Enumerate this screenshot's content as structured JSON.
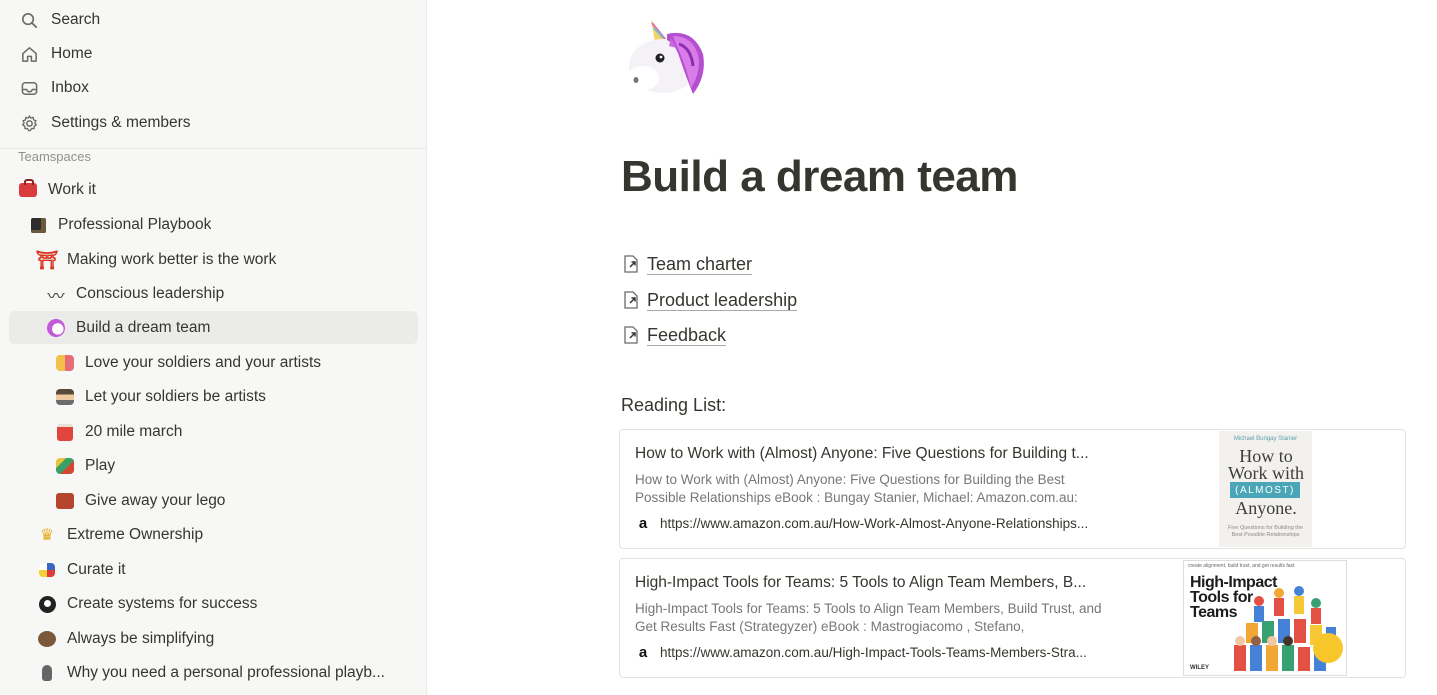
{
  "sidebar": {
    "nav": [
      {
        "label": "Search",
        "icon": "search-icon"
      },
      {
        "label": "Home",
        "icon": "home-icon"
      },
      {
        "label": "Inbox",
        "icon": "inbox-icon"
      },
      {
        "label": "Settings & members",
        "icon": "gear-icon"
      }
    ],
    "section_label": "Teamspaces",
    "tree": [
      {
        "label": "Work it",
        "icon": "toolbox-emoji-icon",
        "depth": 0
      },
      {
        "label": "Professional Playbook",
        "icon": "cube-emoji-icon",
        "depth": 1
      },
      {
        "label": "Making work better is the work",
        "icon": "torii-gate-emoji-icon",
        "depth": 2
      },
      {
        "label": "Conscious leadership",
        "icon": "wavy-dash-emoji-icon",
        "depth": 3
      },
      {
        "label": "Build a dream team",
        "icon": "unicorn-emoji-icon",
        "depth": 3,
        "selected": true
      },
      {
        "label": "Love your soldiers and your artists",
        "icon": "couple-emoji-icon",
        "depth": 4
      },
      {
        "label": "Let your soldiers be artists",
        "icon": "artist-emoji-icon",
        "depth": 4
      },
      {
        "label": "20 mile march",
        "icon": "drum-emoji-icon",
        "depth": 4
      },
      {
        "label": "Play",
        "icon": "roller-coaster-emoji-icon",
        "depth": 4
      },
      {
        "label": "Give away your lego",
        "icon": "brick-emoji-icon",
        "depth": 4
      },
      {
        "label": "Extreme Ownership",
        "icon": "crown-emoji-icon",
        "depth": 2
      },
      {
        "label": "Curate it",
        "icon": "art-frame-emoji-icon",
        "depth": 2
      },
      {
        "label": "Create systems for success",
        "icon": "pool-8-ball-emoji-icon",
        "depth": 2
      },
      {
        "label": "Always be simplifying",
        "icon": "bear-emoji-icon",
        "depth": 2
      },
      {
        "label": "Why you need a personal professional playb...",
        "icon": "microphone-emoji-icon",
        "depth": 2
      }
    ]
  },
  "page": {
    "icon": "unicorn-emoji-icon",
    "title": "Build a dream team",
    "links": [
      {
        "label": "Team charter"
      },
      {
        "label": "Product leadership"
      },
      {
        "label": "Feedback"
      }
    ],
    "reading_label": "Reading List:",
    "bookmarks": [
      {
        "title": "How to Work with (Almost) Anyone: Five Questions for Building t...",
        "description": "How to Work with (Almost) Anyone: Five Questions for Building the Best Possible Relationships eBook : Bungay Stanier, Michael: Amazon.com.au:",
        "url": "https://www.amazon.com.au/How-Work-Almost-Anyone-Relationships...",
        "cover": {
          "author": "Michael Bungay Stanier",
          "title_line1": "How to",
          "title_line2": "Work with",
          "title_badge": "(ALMOST)",
          "title_line3": "Anyone.",
          "subtitle": "Five Questions for Building the Best Possible Relationships"
        }
      },
      {
        "title": "High-Impact Tools for Teams: 5 Tools to Align Team Members, B...",
        "description": "High-Impact Tools for Teams: 5 Tools to Align Team Members, Build Trust, and Get Results Fast (Strategyzer) eBook : Mastrogiacomo , Stefano,",
        "url": "https://www.amazon.com.au/High-Impact-Tools-Teams-Members-Stra...",
        "cover": {
          "tagline": "create alignment, build trust, and get results fast",
          "title_line1": "High-Impact",
          "title_line2": "Tools for",
          "title_line3": "Teams",
          "publisher": "WILEY"
        }
      }
    ]
  },
  "colors": {
    "sidebar_bg": "#f7f7f5",
    "selected_bg": "#ebebe9",
    "text": "#37352f",
    "muted": "#91918e"
  }
}
